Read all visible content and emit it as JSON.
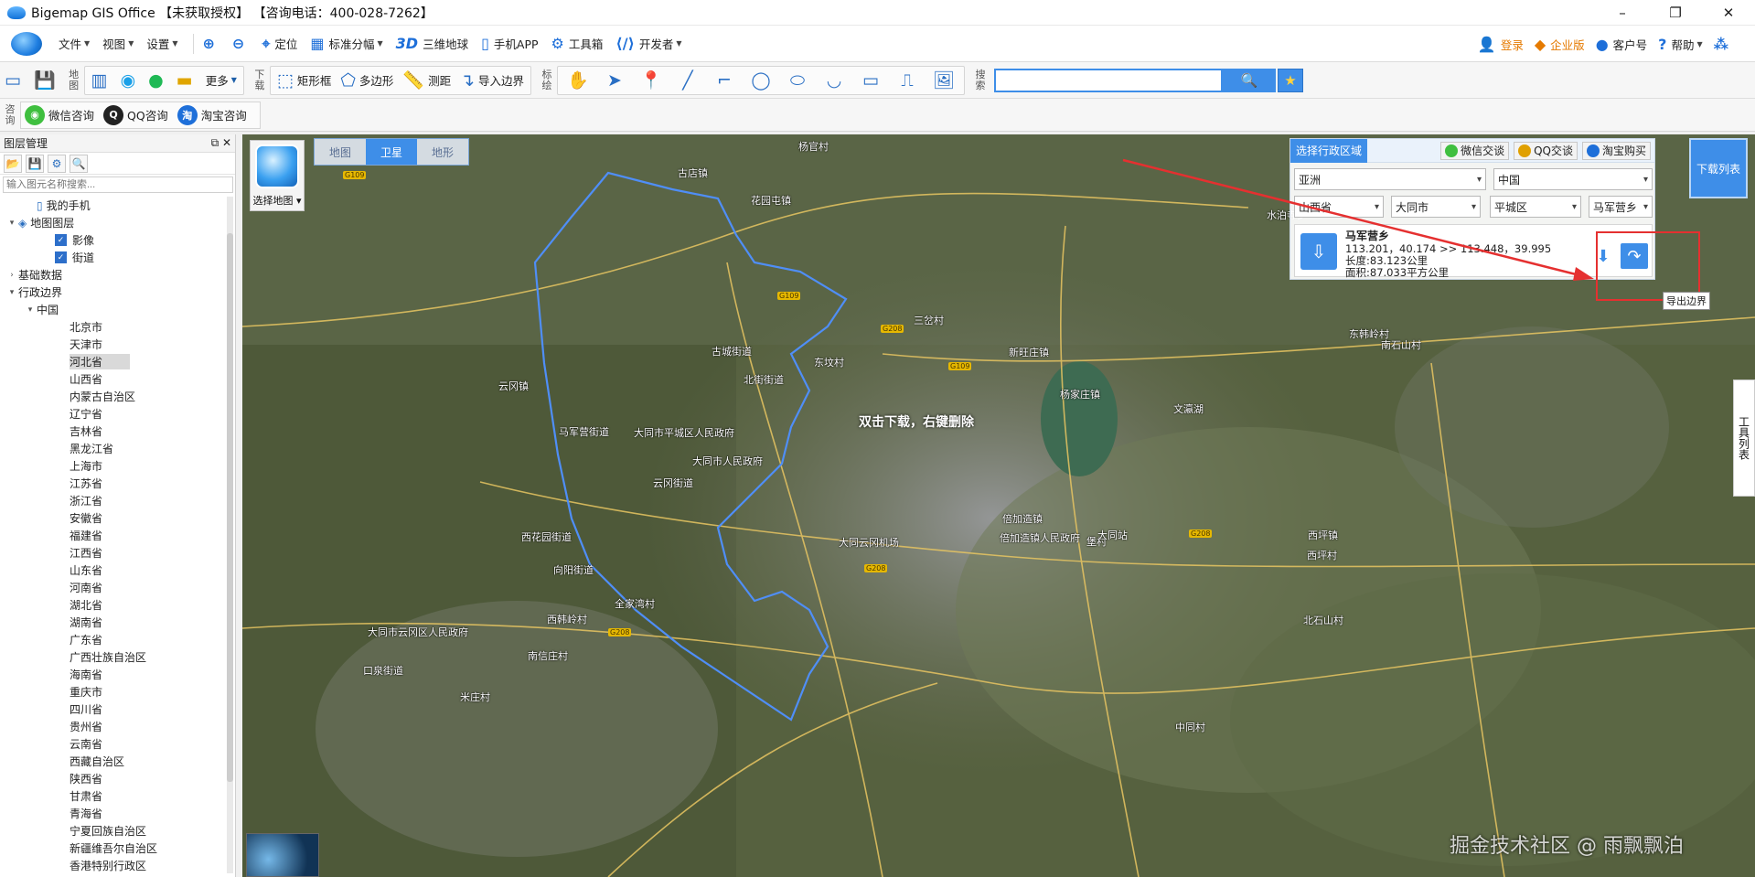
{
  "window": {
    "title": "Bigemap GIS Office 【未获取授权】 【咨询电话：400-028-7262】",
    "controls": [
      "–",
      "❐",
      "✕"
    ]
  },
  "menubar": {
    "file": "文件",
    "view": "视图",
    "settings": "设置",
    "locate": "定位",
    "standard_grid": "标准分幅",
    "globe_3d": "三维地球",
    "mobile_app": "手机APP",
    "toolbox": "工具箱",
    "developer": "开发者",
    "login": "登录",
    "enterprise": "企业版",
    "customer_no": "客户号",
    "help": "帮助"
  },
  "toolbar": {
    "group_map": "地图",
    "more": "更多",
    "group_download": "下载",
    "rect_frame": "矩形框",
    "polygon": "多边形",
    "measure": "测距",
    "import_boundary": "导入边界",
    "group_mark": "标绘",
    "group_search": "搜索",
    "search_value": ""
  },
  "consult": {
    "group_label": "咨询",
    "wechat": "微信咨询",
    "qq": "QQ咨询",
    "taobao": "淘宝咨询"
  },
  "layer_panel": {
    "title": "图层管理",
    "search_placeholder": "输入图元名称搜索...",
    "tree": [
      {
        "label": "我的手机",
        "level": 1,
        "toggle": "",
        "icon": "phone"
      },
      {
        "label": "地图图层",
        "level": 0,
        "toggle": "▾",
        "icon": "layers"
      },
      {
        "label": "影像",
        "level": 2,
        "toggle": "",
        "checked": true
      },
      {
        "label": "街道",
        "level": 2,
        "toggle": "",
        "checked": true
      },
      {
        "label": "基础数据",
        "level": 0,
        "toggle": "›"
      },
      {
        "label": "行政边界",
        "level": 0,
        "toggle": "▾"
      },
      {
        "label": "中国",
        "level": 1,
        "toggle": "▾"
      },
      {
        "label": "北京市",
        "level": 3
      },
      {
        "label": "天津市",
        "level": 3
      },
      {
        "label": "河北省",
        "level": 3,
        "selected": true
      },
      {
        "label": "山西省",
        "level": 3
      },
      {
        "label": "内蒙古自治区",
        "level": 3
      },
      {
        "label": "辽宁省",
        "level": 3
      },
      {
        "label": "吉林省",
        "level": 3
      },
      {
        "label": "黑龙江省",
        "level": 3
      },
      {
        "label": "上海市",
        "level": 3
      },
      {
        "label": "江苏省",
        "level": 3
      },
      {
        "label": "浙江省",
        "level": 3
      },
      {
        "label": "安徽省",
        "level": 3
      },
      {
        "label": "福建省",
        "level": 3
      },
      {
        "label": "江西省",
        "level": 3
      },
      {
        "label": "山东省",
        "level": 3
      },
      {
        "label": "河南省",
        "level": 3
      },
      {
        "label": "湖北省",
        "level": 3
      },
      {
        "label": "湖南省",
        "level": 3
      },
      {
        "label": "广东省",
        "level": 3
      },
      {
        "label": "广西壮族自治区",
        "level": 3
      },
      {
        "label": "海南省",
        "level": 3
      },
      {
        "label": "重庆市",
        "level": 3
      },
      {
        "label": "四川省",
        "level": 3
      },
      {
        "label": "贵州省",
        "level": 3
      },
      {
        "label": "云南省",
        "level": 3
      },
      {
        "label": "西藏自治区",
        "level": 3
      },
      {
        "label": "陕西省",
        "level": 3
      },
      {
        "label": "甘肃省",
        "level": 3
      },
      {
        "label": "青海省",
        "level": 3
      },
      {
        "label": "宁夏回族自治区",
        "level": 3
      },
      {
        "label": "新疆维吾尔自治区",
        "level": 3
      },
      {
        "label": "香港特别行政区",
        "level": 3
      }
    ]
  },
  "map": {
    "tabs": [
      "地图",
      "卫星",
      "地形"
    ],
    "active_tab": "卫星",
    "choose_map": "选择地图",
    "hint": "双击下载，右键删除",
    "download_list": "下载列表",
    "tool_list": "工具列表",
    "export_tooltip": "导出边界",
    "watermark": "掘金技术社区 @ 雨飘飘泊",
    "labels": [
      "杨官村",
      "古店镇",
      "花园屯镇",
      "云冈镇",
      "古城街道",
      "北街街道",
      "东坟村",
      "三岔村",
      "马军营街道",
      "大同市平城区人民政府",
      "大同市人民政府",
      "新旺庄镇",
      "杨家庄镇",
      "西花园街道",
      "全家湾村",
      "西韩岭村",
      "南信庄村",
      "大同市云冈区人民政府",
      "口泉街道",
      "米庄村",
      "倍加造镇",
      "倍加造镇人民政府",
      "堡村",
      "西坪镇",
      "西坪村",
      "北石山村",
      "南石山村",
      "文瀛湖",
      "东韩岭村",
      "大同云冈机场",
      "云冈街道",
      "向阳街道",
      "水泊寺乡",
      "大同站",
      "中同村"
    ],
    "road_codes": [
      "G109",
      "G109",
      "G208",
      "G208",
      "G109",
      "G208",
      "G208"
    ],
    "boundary_color": "#4f8ef7"
  },
  "region_panel": {
    "title": "选择行政区域",
    "wechat": "微信交谈",
    "qq": "QQ交谈",
    "taobao": "淘宝购买",
    "continent": "亚洲",
    "country": "中国",
    "province": "山西省",
    "city": "大同市",
    "district": "平城区",
    "town": "马军营乡",
    "result": {
      "name": "马军营乡",
      "coords": "113.201，40.174 >> 113.448，39.995",
      "length": "长度:83.123公里",
      "area": "面积:87.033平方公里"
    }
  }
}
